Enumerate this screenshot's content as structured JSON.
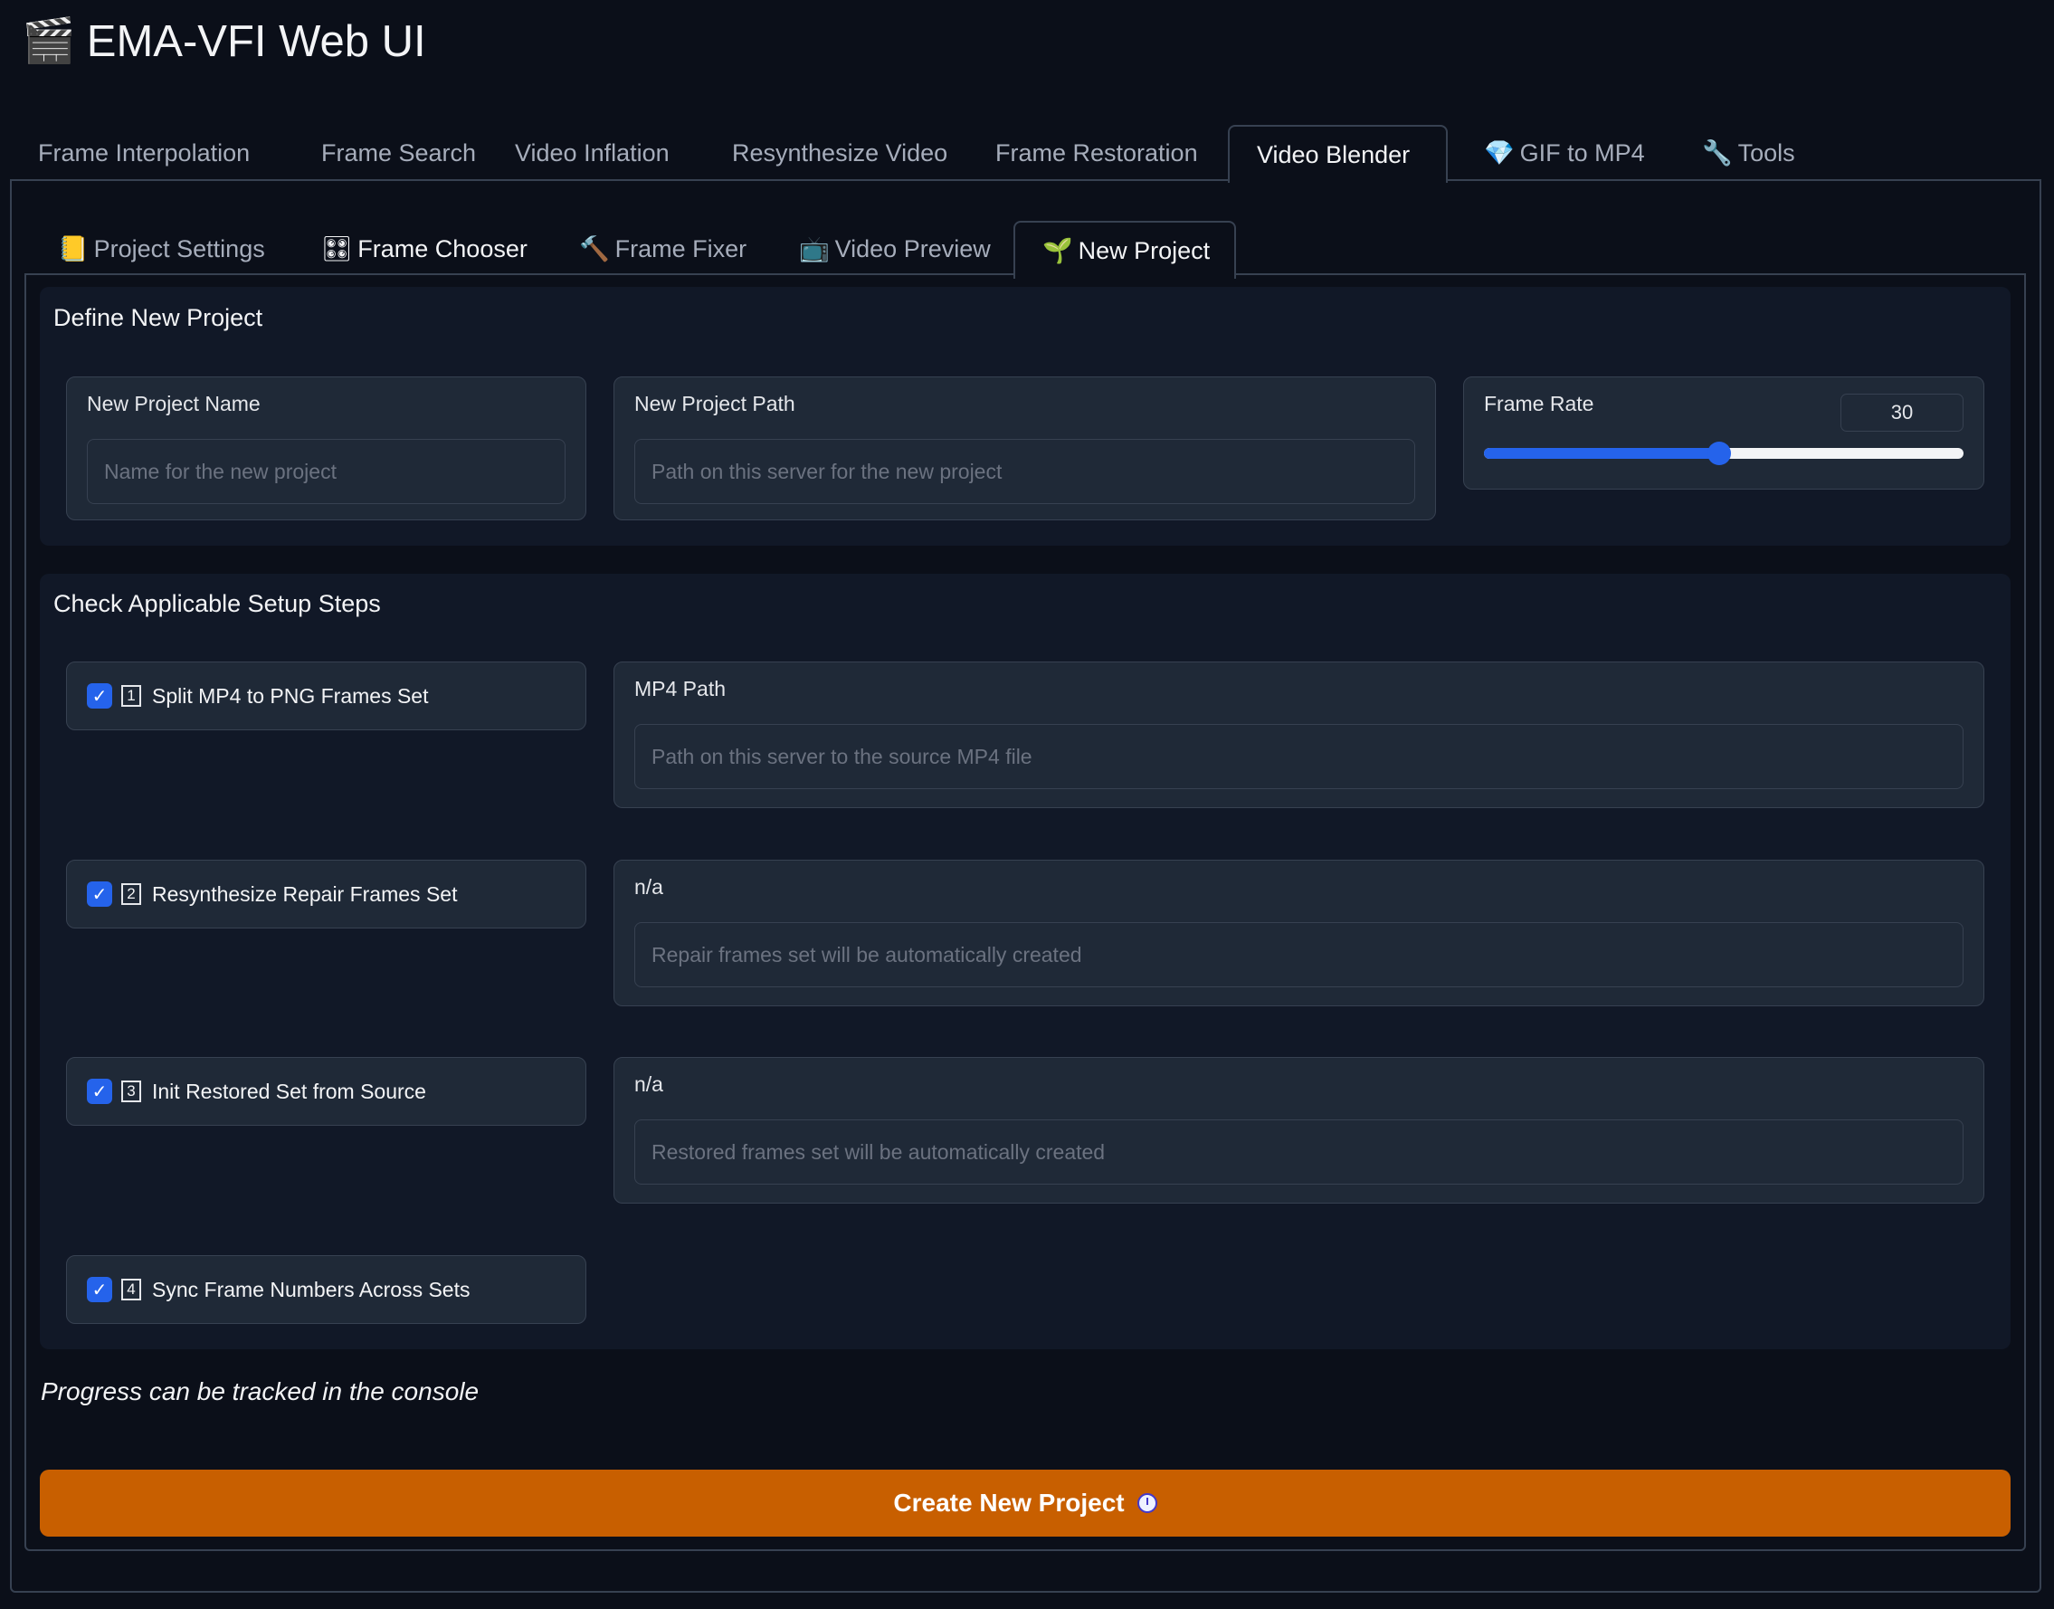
{
  "app": {
    "icon": "clapper-board-icon",
    "icon_glyph": "🎬",
    "title": "EMA-VFI Web UI"
  },
  "top_tabs": [
    {
      "label": "Frame Interpolation",
      "icon": ""
    },
    {
      "label": "Frame Search",
      "icon": ""
    },
    {
      "label": "Video Inflation",
      "icon": ""
    },
    {
      "label": "Resynthesize Video",
      "icon": ""
    },
    {
      "label": "Frame Restoration",
      "icon": ""
    },
    {
      "label": "Video Blender",
      "icon": "",
      "active": true
    },
    {
      "label": "GIF to MP4",
      "icon": "💎"
    },
    {
      "label": "Tools",
      "icon": "🔧"
    }
  ],
  "sub_tabs": [
    {
      "label": "Project Settings",
      "icon": "📒"
    },
    {
      "label": "Frame Chooser",
      "icon": "🎛"
    },
    {
      "label": "Frame Fixer",
      "icon": "🔨"
    },
    {
      "label": "Video Preview",
      "icon": "📺"
    },
    {
      "label": "New Project",
      "icon": "🌱",
      "active": true
    }
  ],
  "define": {
    "title": "Define New Project",
    "name_label": "New Project Name",
    "name_placeholder": "Name for the new project",
    "path_label": "New Project Path",
    "path_placeholder": "Path on this server for the new project",
    "frame_rate_label": "Frame Rate",
    "frame_rate_value": "30",
    "frame_rate_fraction": 0.49
  },
  "setup": {
    "title": "Check Applicable Setup Steps",
    "steps": [
      {
        "num": "1",
        "label": "Split MP4 to PNG Frames Set",
        "checked": true
      },
      {
        "num": "2",
        "label": "Resynthesize Repair Frames Set",
        "checked": true
      },
      {
        "num": "3",
        "label": "Init Restored Set from Source",
        "checked": true
      },
      {
        "num": "4",
        "label": "Sync Frame Numbers Across Sets",
        "checked": true
      }
    ],
    "mp4_label": "MP4 Path",
    "mp4_placeholder": "Path on this server to the source MP4 file",
    "repair_label": "n/a",
    "repair_placeholder": "Repair frames set will be automatically created",
    "restored_label": "n/a",
    "restored_placeholder": "Restored frames set will be automatically created"
  },
  "progress_note": "Progress can be tracked in the console",
  "create_button": {
    "label": "Create New Project",
    "icon": "clock-icon"
  },
  "colors": {
    "background": "#0b0f19",
    "block": "#1f2937",
    "accent": "#2563eb",
    "primary_button": "#c85f00"
  }
}
